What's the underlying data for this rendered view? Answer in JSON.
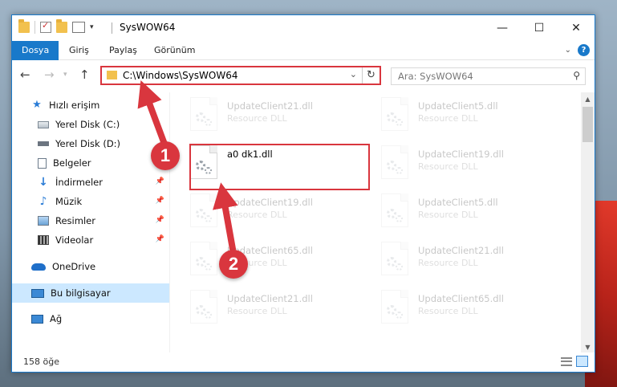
{
  "window": {
    "title": "SysWOW64"
  },
  "ribbon": {
    "tabs": [
      "Dosya",
      "Giriş",
      "Paylaş",
      "Görünüm"
    ]
  },
  "address": {
    "path": "C:\\Windows\\SysWOW64",
    "search_placeholder": "Ara: SysWOW64"
  },
  "nav": {
    "items": [
      {
        "label": "Hızlı erişim",
        "icon": "star-icon"
      },
      {
        "label": "Yerel Disk (C:)",
        "icon": "disk-icon"
      },
      {
        "label": "Yerel Disk (D:)",
        "icon": "disk-icon"
      },
      {
        "label": "Belgeler",
        "icon": "documents-icon"
      },
      {
        "label": "İndirmeler",
        "icon": "downloads-icon"
      },
      {
        "label": "Müzik",
        "icon": "music-icon"
      },
      {
        "label": "Resimler",
        "icon": "pictures-icon"
      },
      {
        "label": "Videolar",
        "icon": "videos-icon"
      },
      {
        "label": "OneDrive",
        "icon": "cloud-icon"
      },
      {
        "label": "Bu bilgisayar",
        "icon": "computer-icon",
        "selected": true
      },
      {
        "label": "Ağ",
        "icon": "network-icon"
      }
    ]
  },
  "files": {
    "highlighted": {
      "name": "a0 dk1.dll",
      "type": ""
    },
    "items": [
      {
        "name": "UpdateClient21.dll",
        "type": "Resource DLL"
      },
      {
        "name": "UpdateClient5.dll",
        "type": "Resource DLL"
      },
      {
        "name": "UpdateClient19.dll",
        "type": "Resource DLL"
      },
      {
        "name": "UpdateClient19.dll",
        "type": "Resource DLL"
      },
      {
        "name": "UpdateClient5.dll",
        "type": "Resource DLL"
      },
      {
        "name": "UpdateClient65.dll",
        "type": "Resource DLL"
      },
      {
        "name": "UpdateClient21.dll",
        "type": "Resource DLL"
      },
      {
        "name": "UpdateClient21.dll",
        "type": "Resource DLL"
      },
      {
        "name": "UpdateClient65.dll",
        "type": "Resource DLL"
      }
    ]
  },
  "status": {
    "count": "158 öğe"
  },
  "annotations": {
    "step1": "1",
    "step2": "2"
  },
  "colors": {
    "accent": "#1979ca",
    "highlight": "#d9363e",
    "selected": "#cce8ff"
  }
}
